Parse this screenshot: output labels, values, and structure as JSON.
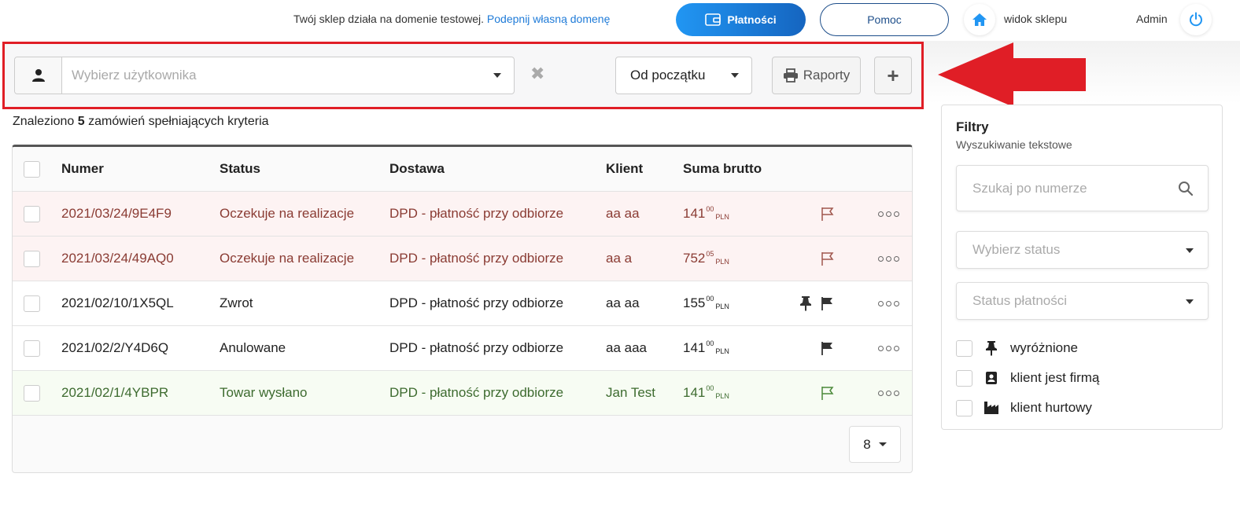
{
  "topbar": {
    "domain_note": "Twój sklep działa na domenie testowej.",
    "domain_link": "Podepnij własną domenę",
    "payments_label": "Płatności",
    "help_label": "Pomoc",
    "shop_view_label": "widok sklepu",
    "admin_label": "Admin"
  },
  "filterbar": {
    "user_placeholder": "Wybierz użytkownika",
    "clear_symbol": "✖",
    "period_value": "Od początku",
    "reports_label": "Raporty",
    "add_symbol": "+"
  },
  "summary": {
    "prefix": "Znaleziono",
    "count": "5",
    "suffix": "zamówień spełniających kryteria"
  },
  "table": {
    "headers": [
      "Numer",
      "Status",
      "Dostawa",
      "Klient",
      "Suma brutto"
    ],
    "rows": [
      {
        "number": "2021/03/24/9E4F9",
        "status": "Oczekuje na realizacje",
        "shipping": "DPD - płatność przy odbiorze",
        "client": "aa aa",
        "sum_int": "141",
        "sum_dec": "00",
        "currency": "PLN"
      },
      {
        "number": "2021/03/24/49AQ0",
        "status": "Oczekuje na realizacje",
        "shipping": "DPD - płatność przy odbiorze",
        "client": "aa a",
        "sum_int": "752",
        "sum_dec": "05",
        "currency": "PLN"
      },
      {
        "number": "2021/02/10/1X5QL",
        "status": "Zwrot",
        "shipping": "DPD - płatność przy odbiorze",
        "client": "aa aa",
        "sum_int": "155",
        "sum_dec": "00",
        "currency": "PLN"
      },
      {
        "number": "2021/02/2/Y4D6Q",
        "status": "Anulowane",
        "shipping": "DPD - płatność przy odbiorze",
        "client": "aa aaa",
        "sum_int": "141",
        "sum_dec": "00",
        "currency": "PLN"
      },
      {
        "number": "2021/02/1/4YBPR",
        "status": "Towar wysłano",
        "shipping": "DPD - płatność przy odbiorze",
        "client": "Jan Test",
        "sum_int": "141",
        "sum_dec": "00",
        "currency": "PLN"
      }
    ],
    "page_size": "8"
  },
  "filters": {
    "title": "Filtry",
    "subtitle": "Wyszukiwanie tekstowe",
    "search_placeholder": "Szukaj po numerze",
    "status_placeholder": "Wybierz status",
    "payment_status_placeholder": "Status płatności",
    "checkboxes": [
      "wyróżnione",
      "klient jest firmą",
      "klient hurtowy"
    ]
  },
  "colors": {
    "accent_blue": "#1f7bd8",
    "highlight_red": "#e01e26",
    "row_red_text": "#8a3b33",
    "row_green_text": "#3d6b2f"
  }
}
